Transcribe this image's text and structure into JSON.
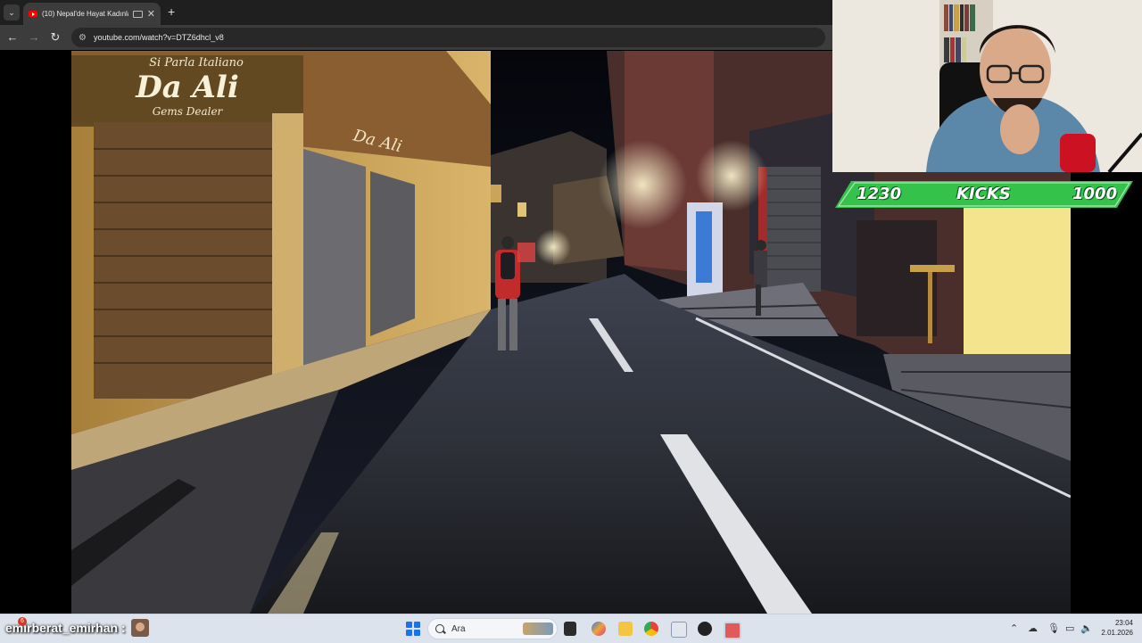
{
  "browser": {
    "tab": {
      "title": "(10) Nepal'de Hayat Kadınla",
      "close_glyph": "✕",
      "favicon": "youtube-icon"
    },
    "new_tab_glyph": "+",
    "tab_list_glyph": "⌄",
    "nav": {
      "back_glyph": "←",
      "forward_glyph": "→",
      "reload_glyph": "↻"
    },
    "site_info_glyph": "⚙",
    "url": "youtube.com/watch?v=DTZ6dhcl_v8"
  },
  "video": {
    "scene": "night street walk",
    "sign_main": "Da Ali",
    "sign_top": "Si Parla Italiano",
    "sign_sub": "Gems Dealer",
    "sign_side": "Da Ali"
  },
  "overlay": {
    "kicks_left": "1230",
    "kicks_label": "KICKS",
    "kicks_right": "1000",
    "kicks_color": "#35c24a",
    "chat_user": "emirberat_emirhan :",
    "chat_badge": "6"
  },
  "taskbar": {
    "search_placeholder": "Ara",
    "time": "23:04",
    "date": "2.01.2026",
    "accent": "#1a73e8",
    "apps": [
      "task-view-icon",
      "copilot-icon",
      "file-explorer-icon",
      "chrome-icon",
      "snipping-tool-icon",
      "obs-icon",
      "app-icon"
    ]
  }
}
